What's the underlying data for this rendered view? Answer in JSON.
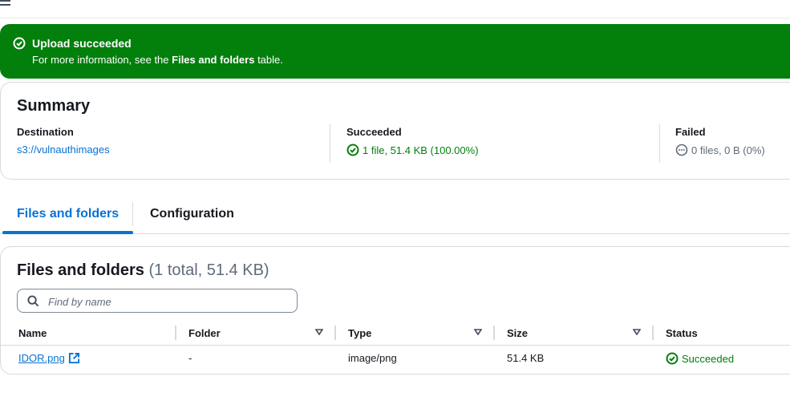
{
  "flash": {
    "title": "Upload succeeded",
    "desc_prefix": "For more information, see the ",
    "desc_bold": "Files and folders",
    "desc_suffix": " table.",
    "color": "#037f0c"
  },
  "summary": {
    "title": "Summary",
    "destination": {
      "label": "Destination",
      "value": "s3://vulnauthimages"
    },
    "succeeded": {
      "label": "Succeeded",
      "value": "1 file, 51.4 KB (100.00%)"
    },
    "failed": {
      "label": "Failed",
      "value": "0 files, 0 B (0%)"
    }
  },
  "tabs": [
    {
      "label": "Files and folders",
      "active": true
    },
    {
      "label": "Configuration",
      "active": false
    }
  ],
  "files": {
    "title": "Files and folders",
    "count": "(1 total, 51.4 KB)",
    "search_placeholder": "Find by name",
    "columns": [
      "Name",
      "Folder",
      "Type",
      "Size",
      "Status"
    ],
    "rows": [
      {
        "name": "IDOR.png",
        "folder": "-",
        "type": "image/png",
        "size": "51.4 KB",
        "status": "Succeeded"
      }
    ]
  },
  "colors": {
    "link": "#0972d3",
    "success": "#037f0c",
    "border": "#d5dbdb"
  },
  "icons": [
    "menu-icon",
    "success-check-icon",
    "pending-circle-icon",
    "search-icon",
    "sort-caret-icon",
    "external-link-icon"
  ]
}
